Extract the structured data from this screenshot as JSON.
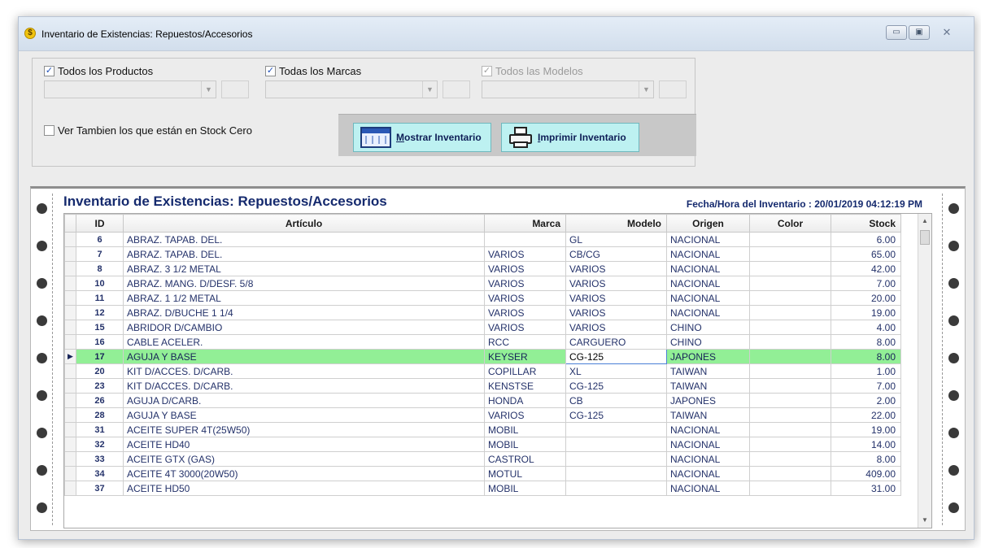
{
  "window": {
    "title": "Inventario de Existencias: Repuestos/Accesorios",
    "icon": "dollar-coin-icon",
    "controls": {
      "minimize": "▭",
      "maximize": "▣",
      "close": "✕"
    }
  },
  "filters": {
    "productos": {
      "label": "Todos los Productos",
      "checked": true
    },
    "marcas": {
      "label": "Todas los Marcas",
      "checked": true
    },
    "modelos": {
      "label": "Todos las Modelos",
      "checked": true,
      "disabled": true
    },
    "stock_cero": {
      "label": "Ver Tambien los que están en Stock Cero",
      "checked": false
    }
  },
  "buttons": {
    "mostrar": {
      "accel": "M",
      "rest": "ostrar Inventario"
    },
    "imprimir": {
      "accel": "I",
      "rest": "mprimir Inventario"
    }
  },
  "report": {
    "title": "Inventario de Existencias: Repuestos/Accesorios",
    "date_label": "Fecha/Hora del Inventario : 20/01/2019 04:12:19 PM"
  },
  "table": {
    "columns": [
      "ID",
      "Artículo",
      "Marca",
      "Modelo",
      "Origen",
      "Color",
      "Stock"
    ],
    "selected_index": 8,
    "rows": [
      {
        "id": "6",
        "articulo": "ABRAZ. TAPAB. DEL.",
        "marca": "",
        "modelo": "GL",
        "origen": "NACIONAL",
        "color": "",
        "stock": "6.00"
      },
      {
        "id": "7",
        "articulo": "ABRAZ. TAPAB. DEL.",
        "marca": "VARIOS",
        "modelo": "CB/CG",
        "origen": "NACIONAL",
        "color": "",
        "stock": "65.00"
      },
      {
        "id": "8",
        "articulo": "ABRAZ. 3 1/2 METAL",
        "marca": "VARIOS",
        "modelo": "VARIOS",
        "origen": "NACIONAL",
        "color": "",
        "stock": "42.00"
      },
      {
        "id": "10",
        "articulo": "ABRAZ. MANG. D/DESF. 5/8",
        "marca": "VARIOS",
        "modelo": "VARIOS",
        "origen": "NACIONAL",
        "color": "",
        "stock": "7.00"
      },
      {
        "id": "11",
        "articulo": "ABRAZ. 1 1/2 METAL",
        "marca": "VARIOS",
        "modelo": "VARIOS",
        "origen": "NACIONAL",
        "color": "",
        "stock": "20.00"
      },
      {
        "id": "12",
        "articulo": "ABRAZ. D/BUCHE 1 1/4",
        "marca": "VARIOS",
        "modelo": "VARIOS",
        "origen": "NACIONAL",
        "color": "",
        "stock": "19.00"
      },
      {
        "id": "15",
        "articulo": "ABRIDOR D/CAMBIO",
        "marca": "VARIOS",
        "modelo": "VARIOS",
        "origen": "CHINO",
        "color": "",
        "stock": "4.00"
      },
      {
        "id": "16",
        "articulo": "CABLE ACELER.",
        "marca": "RCC",
        "modelo": "CARGUERO",
        "origen": "CHINO",
        "color": "",
        "stock": "8.00"
      },
      {
        "id": "17",
        "articulo": "AGUJA Y BASE",
        "marca": "KEYSER",
        "modelo": "CG-125",
        "origen": "JAPONES",
        "color": "",
        "stock": "8.00"
      },
      {
        "id": "20",
        "articulo": "KIT D/ACCES. D/CARB.",
        "marca": "COPILLAR",
        "modelo": "XL",
        "origen": "TAIWAN",
        "color": "",
        "stock": "1.00"
      },
      {
        "id": "23",
        "articulo": "KIT D/ACCES. D/CARB.",
        "marca": "KENSTSE",
        "modelo": "CG-125",
        "origen": "TAIWAN",
        "color": "",
        "stock": "7.00"
      },
      {
        "id": "26",
        "articulo": "AGUJA D/CARB.",
        "marca": "HONDA",
        "modelo": "CB",
        "origen": "JAPONES",
        "color": "",
        "stock": "2.00"
      },
      {
        "id": "28",
        "articulo": "AGUJA Y BASE",
        "marca": "VARIOS",
        "modelo": "CG-125",
        "origen": "TAIWAN",
        "color": "",
        "stock": "22.00"
      },
      {
        "id": "31",
        "articulo": "ACEITE SUPER 4T(25W50)",
        "marca": "MOBIL",
        "modelo": "",
        "origen": "NACIONAL",
        "color": "",
        "stock": "19.00"
      },
      {
        "id": "32",
        "articulo": "ACEITE HD40",
        "marca": "MOBIL",
        "modelo": "",
        "origen": "NACIONAL",
        "color": "",
        "stock": "14.00"
      },
      {
        "id": "33",
        "articulo": "ACEITE GTX (GAS)",
        "marca": "CASTROL",
        "modelo": "",
        "origen": "NACIONAL",
        "color": "",
        "stock": "8.00"
      },
      {
        "id": "34",
        "articulo": "ACEITE 4T 3000(20W50)",
        "marca": "MOTUL",
        "modelo": "",
        "origen": "NACIONAL",
        "color": "",
        "stock": "409.00"
      },
      {
        "id": "37",
        "articulo": "ACEITE HD50",
        "marca": "MOBIL",
        "modelo": "",
        "origen": "NACIONAL",
        "color": "",
        "stock": "31.00"
      }
    ]
  },
  "colors": {
    "selected_row": "#92ef96",
    "text_blue": "#24326a",
    "button_bg": "#bdf1f1"
  }
}
